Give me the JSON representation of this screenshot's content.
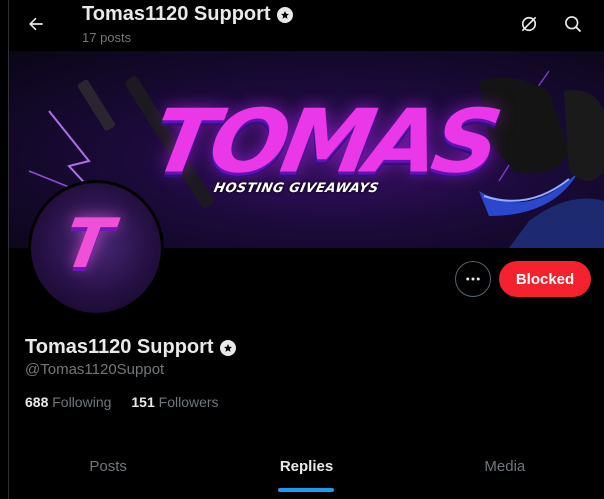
{
  "header": {
    "title": "Tomas1120 Support",
    "post_count": "17 posts"
  },
  "banner": {
    "logo_text": "TOMAS",
    "logo_subtext": "HOSTING GIVEAWAYS"
  },
  "avatar": {
    "letter": "T"
  },
  "actions": {
    "blocked_label": "Blocked"
  },
  "profile": {
    "name": "Tomas1120 Support",
    "handle": "@Tomas1120Suppot",
    "following_count": "688",
    "following_label": "Following",
    "followers_count": "151",
    "followers_label": "Followers"
  },
  "tabs": [
    {
      "label": "Posts",
      "active": false
    },
    {
      "label": "Replies",
      "active": true
    },
    {
      "label": "Media",
      "active": false
    }
  ],
  "colors": {
    "background": "#000000",
    "text_primary": "#e7e9ea",
    "text_secondary": "#71767b",
    "blocked_red": "#f4212e",
    "tab_accent": "#1d9bf0"
  },
  "icons": [
    "back-arrow-icon",
    "verified-badge-icon",
    "grok-icon",
    "search-icon",
    "more-dots-icon"
  ]
}
